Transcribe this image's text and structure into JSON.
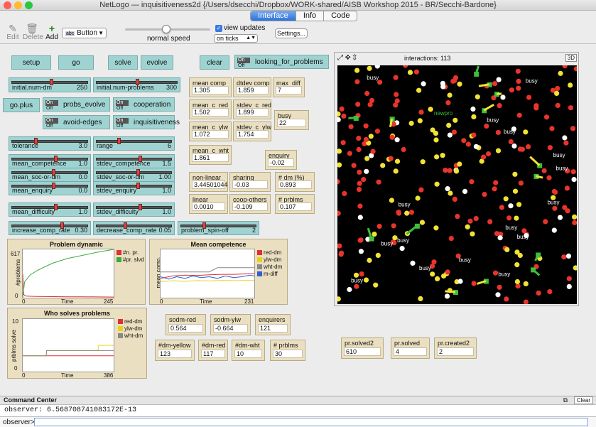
{
  "window": {
    "title": "NetLogo — inquisitiveness2d {/Users/dsecchi/Dropbox/WORK-shared/AISB Workshop 2015 - BR/Secchi-Bardone}"
  },
  "tabs": [
    "Interface",
    "Info",
    "Code"
  ],
  "toolbar": {
    "edit": "Edit",
    "delete": "Delete",
    "add": "Add",
    "widget_type": "Button",
    "speed_label": "normal speed",
    "view_updates": "view updates",
    "update_mode": "on ticks",
    "settings": "Settings..."
  },
  "buttons": {
    "setup": "setup",
    "go": "go",
    "solve": "solve",
    "evolve": "evolve",
    "clear": "clear",
    "go_plus": "go.plus"
  },
  "switches": {
    "looking_for_problems": "looking_for_problems",
    "probs_evolve": "probs_evolve",
    "cooperation": "cooperation",
    "avoid_edges": "avoid-edges",
    "inquisitiveness": "inquisitiveness",
    "on": "On",
    "off": "Off"
  },
  "sliders": {
    "initial_num_dm": {
      "label": "initial.num-dm",
      "value": "250"
    },
    "initial_num_problems": {
      "label": "initial.num-problems",
      "value": "300"
    },
    "tolerance": {
      "label": "tolerance",
      "value": "3.0"
    },
    "range": {
      "label": "range",
      "value": "6"
    },
    "mean_competence": {
      "label": "mean_competence",
      "value": "1.0"
    },
    "stdev_competence": {
      "label": "stdev_competence",
      "value": "1.5"
    },
    "mean_soc_or_dm": {
      "label": "mean_soc-or-dm",
      "value": "0.0"
    },
    "stdev_soc_or_dm": {
      "label": "stdev_soc-or-dm",
      "value": "1.00"
    },
    "mean_enquiry": {
      "label": "mean_enquiry",
      "value": "0.0"
    },
    "stdev_enquiry": {
      "label": "stdev_enquiry",
      "value": "1.0"
    },
    "mean_difficulty": {
      "label": "mean_difficulty",
      "value": "1.0"
    },
    "stdev_difficulty": {
      "label": "stdev_difficulty",
      "value": "1.0"
    },
    "increase_comp_rate": {
      "label": "increase_comp_rate",
      "value": "0.30"
    },
    "decrease_comp_rate": {
      "label": "decrease_comp_rate",
      "value": "0.05"
    },
    "problem_spin_off": {
      "label": "problem_spin-off",
      "value": "2"
    }
  },
  "monitors": {
    "mean_comp": {
      "label": "mean comp",
      "value": "1.305"
    },
    "dtdev_comp": {
      "label": "dtdev comp",
      "value": "1.859"
    },
    "max_diff": {
      "label": "max_diff",
      "value": "7"
    },
    "mean_c_red": {
      "label": "mean_c_red",
      "value": "1.502"
    },
    "stdev_c_red": {
      "label": "stdev_c_red",
      "value": "1.899"
    },
    "busy": {
      "label": "busy",
      "value": "22"
    },
    "mean_c_ylw": {
      "label": "mean_c_ylw",
      "value": "1.072"
    },
    "stdev_c_ylw": {
      "label": "stdev_c_ylw",
      "value": "1.754"
    },
    "mean_c_wht": {
      "label": "mean_c_wht",
      "value": "1.861"
    },
    "enquiry": {
      "label": "enquiry",
      "value": "-0.02"
    },
    "non_linear": {
      "label": "non-linear",
      "value": "3.44501044"
    },
    "sharing": {
      "label": "sharing",
      "value": "-0.03"
    },
    "pct_dm": {
      "label": "# dm (%)",
      "value": "0.893"
    },
    "linear": {
      "label": "linear",
      "value": "0.0010"
    },
    "coop_others": {
      "label": "coop-others",
      "value": "-0.109"
    },
    "pct_prblms": {
      "label": "# prblms (%)",
      "value": "0.107"
    },
    "sodm_red": {
      "label": "sodm-red",
      "value": "0.564"
    },
    "sodm_ylw": {
      "label": "sodm-ylw",
      "value": "-0.664"
    },
    "enquirers": {
      "label": "enquirers",
      "value": "121"
    },
    "dm_yellow": {
      "label": "#dm-yellow",
      "value": "123"
    },
    "dm_red": {
      "label": "#dm-red",
      "value": "117"
    },
    "dm_wht": {
      "label": "#dm-wht",
      "value": "10"
    },
    "prblms": {
      "label": "# prblms",
      "value": "30"
    },
    "pr_solved2": {
      "label": "pr.solved2",
      "value": "610"
    },
    "pr_solved": {
      "label": "pr.solved",
      "value": "4"
    },
    "pr_created2": {
      "label": "pr.created2",
      "value": "2"
    }
  },
  "plots": {
    "problem_dynamic": {
      "title": "Problem dynamic",
      "ylabel": "#problems",
      "xlabel": "Time",
      "xmin": "0",
      "xmax": "245",
      "ymin": "0",
      "ymax": "617",
      "legend": [
        "#n. pr.",
        "#pr. slvd"
      ]
    },
    "mean_competence": {
      "title": "Mean competence",
      "ylabel": "mean comp.",
      "xlabel": "Time",
      "xmin": "0",
      "xmax": "231",
      "legend": [
        "red-dm",
        "ylw-dm",
        "wht-dm",
        "m-diff"
      ]
    },
    "who_solves": {
      "title": "Who solves problems",
      "ylabel": "prblms solve",
      "xlabel": "Time",
      "xmin": "0",
      "xmax": "386",
      "ymin": "0",
      "ymax": "10",
      "legend": [
        "red-dm",
        "ylw-dm",
        "wht-dm"
      ]
    }
  },
  "chart_data": [
    {
      "type": "line",
      "title": "Problem dynamic",
      "xlabel": "Time",
      "ylabel": "#problems",
      "xlim": [
        0,
        245
      ],
      "ylim": [
        0,
        617
      ],
      "series": [
        {
          "name": "#n. pr.",
          "color": "#e03030",
          "x": [
            0,
            3,
            6,
            10,
            20,
            40,
            80,
            120,
            160,
            200,
            245
          ],
          "y": [
            300,
            40,
            25,
            20,
            18,
            15,
            14,
            12,
            12,
            10,
            8
          ]
        },
        {
          "name": "#pr. slvd",
          "color": "#3aaa3a",
          "x": [
            0,
            5,
            20,
            40,
            80,
            120,
            160,
            200,
            245
          ],
          "y": [
            0,
            200,
            290,
            350,
            440,
            500,
            540,
            580,
            617
          ]
        }
      ]
    },
    {
      "type": "line",
      "title": "Mean competence",
      "xlabel": "Time",
      "ylabel": "mean comp.",
      "xlim": [
        0,
        231
      ],
      "ylim": [
        0,
        3
      ],
      "series": [
        {
          "name": "red-dm",
          "color": "#e03030",
          "x": [
            0,
            30,
            60,
            90,
            120,
            150,
            180,
            210,
            231
          ],
          "y": [
            1.2,
            1.35,
            1.4,
            1.38,
            1.42,
            1.45,
            1.45,
            1.48,
            1.5
          ]
        },
        {
          "name": "ylw-dm",
          "color": "#e8d020",
          "x": [
            0,
            30,
            60,
            90,
            120,
            150,
            180,
            210,
            231
          ],
          "y": [
            1.0,
            1.05,
            1.02,
            1.06,
            1.04,
            1.07,
            1.06,
            1.07,
            1.07
          ]
        },
        {
          "name": "wht-dm",
          "color": "#888888",
          "x": [
            0,
            60,
            120,
            140,
            180,
            231
          ],
          "y": [
            1.6,
            1.6,
            1.6,
            1.86,
            1.86,
            1.86
          ]
        },
        {
          "name": "m-diff",
          "color": "#3060d0",
          "x": [
            0,
            20,
            40,
            60,
            80,
            100,
            120,
            140,
            160,
            180,
            200,
            220,
            231
          ],
          "y": [
            1.3,
            1.15,
            1.3,
            1.2,
            1.35,
            1.25,
            1.3,
            1.2,
            1.35,
            1.25,
            1.3,
            1.4,
            1.35
          ]
        }
      ]
    },
    {
      "type": "line",
      "title": "Who solves problems",
      "xlabel": "Time",
      "ylabel": "prblms solve",
      "xlim": [
        0,
        386
      ],
      "ylim": [
        0,
        10
      ],
      "series": [
        {
          "name": "red-dm",
          "color": "#e03030",
          "x": [
            0,
            100,
            386
          ],
          "y": [
            3,
            3,
            3
          ]
        },
        {
          "name": "ylw-dm",
          "color": "#e8d020",
          "x": [
            0,
            100,
            101,
            320,
            321,
            386
          ],
          "y": [
            3,
            3,
            4,
            4,
            5,
            5
          ]
        },
        {
          "name": "wht-dm",
          "color": "#888888",
          "x": [
            0,
            100,
            101,
            386
          ],
          "y": [
            3,
            3,
            4,
            4
          ]
        }
      ]
    }
  ],
  "view": {
    "interactions_label": "interactions: 113",
    "threed": "3D",
    "agent_labels": [
      "busy",
      "busy",
      "busy",
      "busy",
      "busy",
      "busy",
      "busy",
      "busy",
      "busy",
      "busy",
      "busy",
      "busy",
      "busy",
      "busy",
      "busy",
      "busy"
    ],
    "new_problem_label": "newpro"
  },
  "command_center": {
    "title": "Command Center",
    "clear": "Clear",
    "output_line": "observer: 6.568708741083172E-13",
    "prompt": "observer>"
  }
}
